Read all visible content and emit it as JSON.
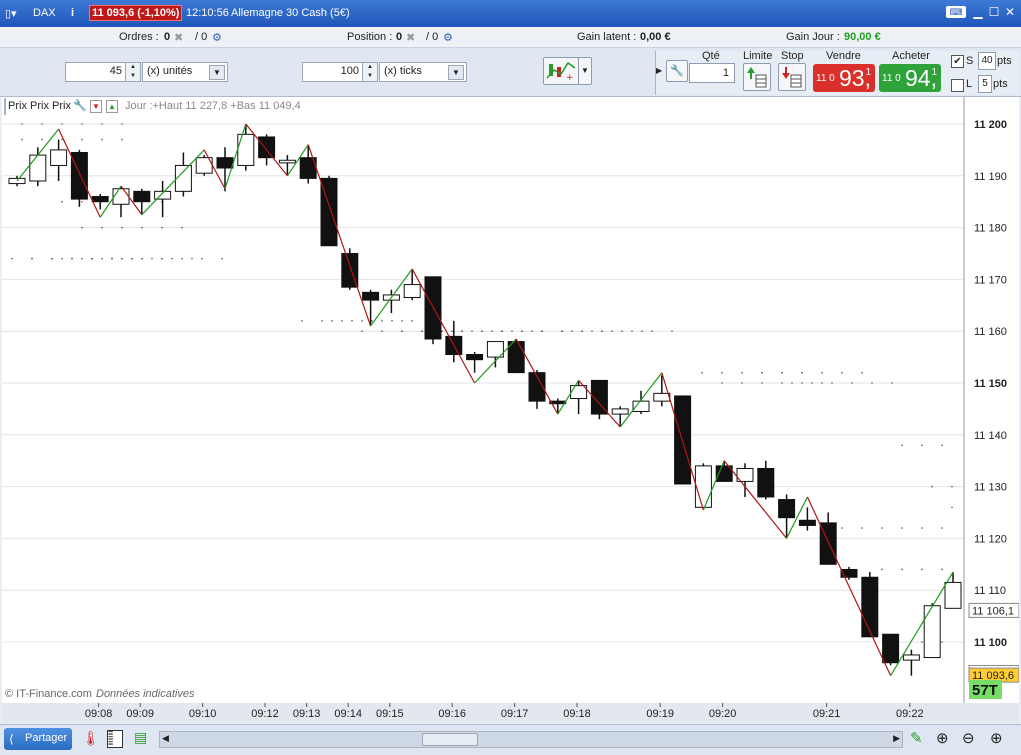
{
  "titlebar": {
    "symbol": "DAX",
    "price_badge": "11 093,6 (-1,10%)",
    "time": "12:10:56",
    "instrument": "Allemagne 30 Cash (5€)"
  },
  "infobar": {
    "orders_label": "Ordres :",
    "orders_value": "0",
    "orders_value2": "/ 0",
    "position_label": "Position :",
    "position_value": "0",
    "position_value2": "/ 0",
    "gain_latent_label": "Gain latent :",
    "gain_latent_value": "0,00 €",
    "gain_jour_label": "Gain Jour :",
    "gain_jour_value": "90,00 €"
  },
  "controls": {
    "units_value": "45",
    "units_select": "(x) unités",
    "ticks_value": "100",
    "ticks_select": "(x) ticks",
    "qty_label": "Qté",
    "qty_value": "1",
    "limit_label": "Limite",
    "stop_label": "Stop",
    "sell_label": "Vendre",
    "buy_label": "Acheter",
    "sell_price_prefix": "11 0",
    "sell_price_big": "93,",
    "sell_price_sup": "1",
    "buy_price_prefix": "11 0",
    "buy_price_big": "94,",
    "buy_price_sup": "1",
    "s_label": "S",
    "s_value": "40",
    "s_unit": "pts",
    "l_label": "L",
    "l_value": "5",
    "l_unit": "pts"
  },
  "chart_legend": {
    "name": "Prix Prix Prix",
    "info": "Jour :+Haut 11 227,8 +Bas 11 049,4"
  },
  "chart_footer": {
    "copyright": "© IT-Finance.com",
    "note": "Données indicatives"
  },
  "bottombar": {
    "share_label": "Partager"
  },
  "colors": {
    "bull_line": "#1f9a1f",
    "bear_line": "#b01515",
    "sell_bg": "#d9302b",
    "buy_bg": "#2fa33a",
    "last_price_bg": "#ffcc33",
    "timer_bg": "#77dd66"
  },
  "chart_data": {
    "type": "candlestick",
    "ylim": [
      11088,
      11205
    ],
    "yticks": [
      {
        "v": 11200,
        "label": "11 200",
        "bold": true
      },
      {
        "v": 11190,
        "label": "11 190"
      },
      {
        "v": 11180,
        "label": "11 180"
      },
      {
        "v": 11170,
        "label": "11 170"
      },
      {
        "v": 11160,
        "label": "11 160"
      },
      {
        "v": 11150,
        "label": "11 150",
        "bold": true
      },
      {
        "v": 11140,
        "label": "11 140"
      },
      {
        "v": 11130,
        "label": "11 130"
      },
      {
        "v": 11120,
        "label": "11 120"
      },
      {
        "v": 11110,
        "label": "11 110"
      },
      {
        "v": 11100,
        "label": "11 100",
        "bold": true
      }
    ],
    "xticks": [
      {
        "i": 2,
        "label": "09:08"
      },
      {
        "i": 4,
        "label": "09:09"
      },
      {
        "i": 7,
        "label": "09:10"
      },
      {
        "i": 10,
        "label": "09:12"
      },
      {
        "i": 12,
        "label": "09:13"
      },
      {
        "i": 14,
        "label": "09:14"
      },
      {
        "i": 16,
        "label": "09:15"
      },
      {
        "i": 19,
        "label": "09:16"
      },
      {
        "i": 22,
        "label": "09:17"
      },
      {
        "i": 25,
        "label": "09:18"
      },
      {
        "i": 29,
        "label": "09:19"
      },
      {
        "i": 32,
        "label": "09:20"
      },
      {
        "i": 37,
        "label": "09:21"
      },
      {
        "i": 41,
        "label": "09:22"
      }
    ],
    "candles": [
      {
        "o": 11188.5,
        "h": 11190,
        "l": 11188,
        "c": 11189.5
      },
      {
        "o": 11189,
        "h": 11195.5,
        "l": 11188,
        "c": 11194
      },
      {
        "o": 11192,
        "h": 11197,
        "l": 11189,
        "c": 11195
      },
      {
        "o": 11194.5,
        "h": 11195,
        "l": 11184,
        "c": 11185.5
      },
      {
        "o": 11186,
        "h": 11186.5,
        "l": 11183.5,
        "c": 11185
      },
      {
        "o": 11184.5,
        "h": 11188,
        "l": 11182,
        "c": 11187.5
      },
      {
        "o": 11187,
        "h": 11187.5,
        "l": 11182.5,
        "c": 11185
      },
      {
        "o": 11185.5,
        "h": 11189,
        "l": 11182,
        "c": 11187
      },
      {
        "o": 11187,
        "h": 11194.5,
        "l": 11186,
        "c": 11192
      },
      {
        "o": 11190.5,
        "h": 11194,
        "l": 11190,
        "c": 11193.5
      },
      {
        "o": 11193.5,
        "h": 11195.5,
        "l": 11187,
        "c": 11191.5
      },
      {
        "o": 11192,
        "h": 11200,
        "l": 11191,
        "c": 11198
      },
      {
        "o": 11197.5,
        "h": 11198,
        "l": 11192,
        "c": 11193.5
      },
      {
        "o": 11192.5,
        "h": 11194,
        "l": 11190,
        "c": 11193
      },
      {
        "o": 11193.5,
        "h": 11196,
        "l": 11188.5,
        "c": 11189.5
      },
      {
        "o": 11189.5,
        "h": 11190,
        "l": 11176.5,
        "c": 11176.5
      },
      {
        "o": 11175,
        "h": 11176,
        "l": 11168,
        "c": 11168.5
      },
      {
        "o": 11167.5,
        "h": 11168,
        "l": 11161,
        "c": 11166
      },
      {
        "o": 11166,
        "h": 11168,
        "l": 11163.5,
        "c": 11167
      },
      {
        "o": 11166.5,
        "h": 11172,
        "l": 11166,
        "c": 11169
      },
      {
        "o": 11170.5,
        "h": 11170.5,
        "l": 11157.5,
        "c": 11158.5
      },
      {
        "o": 11159,
        "h": 11162,
        "l": 11154,
        "c": 11155.5
      },
      {
        "o": 11155.5,
        "h": 11156,
        "l": 11152,
        "c": 11154.5
      },
      {
        "o": 11155,
        "h": 11158,
        "l": 11153,
        "c": 11158
      },
      {
        "o": 11158,
        "h": 11158.5,
        "l": 11152,
        "c": 11152
      },
      {
        "o": 11152,
        "h": 11152.5,
        "l": 11145,
        "c": 11146.5
      },
      {
        "o": 11146.5,
        "h": 11147,
        "l": 11144,
        "c": 11146
      },
      {
        "o": 11147,
        "h": 11150.5,
        "l": 11144,
        "c": 11149.5
      },
      {
        "o": 11150.5,
        "h": 11150.5,
        "l": 11143,
        "c": 11144
      },
      {
        "o": 11144,
        "h": 11145.5,
        "l": 11141.5,
        "c": 11145
      },
      {
        "o": 11144.5,
        "h": 11148.5,
        "l": 11144,
        "c": 11146.5
      },
      {
        "o": 11146.5,
        "h": 11151.5,
        "l": 11145.5,
        "c": 11148
      },
      {
        "o": 11147.5,
        "h": 11147.5,
        "l": 11130.5,
        "c": 11130.5
      },
      {
        "o": 11126,
        "h": 11134.5,
        "l": 11125.5,
        "c": 11134
      },
      {
        "o": 11134,
        "h": 11135,
        "l": 11131.5,
        "c": 11131
      },
      {
        "o": 11131,
        "h": 11134.5,
        "l": 11128,
        "c": 11133.5
      },
      {
        "o": 11133.5,
        "h": 11135,
        "l": 11127.5,
        "c": 11128
      },
      {
        "o": 11127.5,
        "h": 11128.5,
        "l": 11120,
        "c": 11124
      },
      {
        "o": 11123.5,
        "h": 11126,
        "l": 11121.5,
        "c": 11122.5
      },
      {
        "o": 11123,
        "h": 11125,
        "l": 11115,
        "c": 11115
      },
      {
        "o": 11114,
        "h": 11114.5,
        "l": 11112,
        "c": 11112.5
      },
      {
        "o": 11112.5,
        "h": 11113.5,
        "l": 11101,
        "c": 11101
      },
      {
        "o": 11101.5,
        "h": 11101.5,
        "l": 11095.5,
        "c": 11096
      },
      {
        "o": 11096.5,
        "h": 11098.5,
        "l": 11093.5,
        "c": 11097.5
      },
      {
        "o": 11097,
        "h": 11107.5,
        "l": 11097,
        "c": 11107
      },
      {
        "o": 11106.5,
        "h": 11113.5,
        "l": 11106.5,
        "c": 11111.5
      }
    ],
    "zigzag": [
      {
        "i": 0,
        "v": 11189
      },
      {
        "i": 2,
        "v": 11199
      },
      {
        "i": 4,
        "v": 11182
      },
      {
        "i": 5,
        "v": 11188
      },
      {
        "i": 6,
        "v": 11182.5
      },
      {
        "i": 9,
        "v": 11195
      },
      {
        "i": 10,
        "v": 11187.5
      },
      {
        "i": 11,
        "v": 11200
      },
      {
        "i": 13,
        "v": 11190
      },
      {
        "i": 14,
        "v": 11196
      },
      {
        "i": 17,
        "v": 11161
      },
      {
        "i": 19,
        "v": 11172
      },
      {
        "i": 22,
        "v": 11150
      },
      {
        "i": 24,
        "v": 11158.5
      },
      {
        "i": 26,
        "v": 11144
      },
      {
        "i": 27,
        "v": 11150.5
      },
      {
        "i": 29,
        "v": 11141.5
      },
      {
        "i": 31,
        "v": 11152
      },
      {
        "i": 33,
        "v": 11125.5
      },
      {
        "i": 34,
        "v": 11135
      },
      {
        "i": 37,
        "v": 11120
      },
      {
        "i": 38,
        "v": 11128
      },
      {
        "i": 42,
        "v": 11093.5
      },
      {
        "i": 45,
        "v": 11113.5
      }
    ],
    "price_labels": [
      {
        "v": 11106.1,
        "label": "11 106,1"
      },
      {
        "v": 11094.1,
        "label": "11 094,1"
      },
      {
        "v": 11093.6,
        "label": "11 093,6",
        "highlight": true
      }
    ],
    "timer_label": "57T"
  }
}
